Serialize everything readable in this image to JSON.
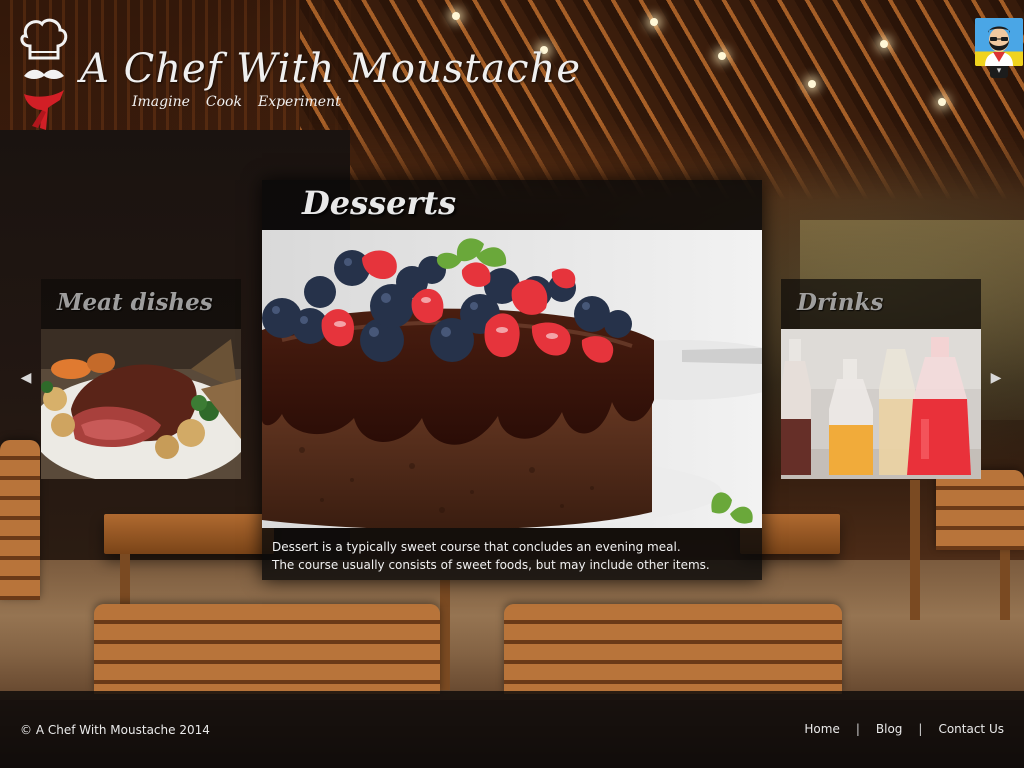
{
  "header": {
    "site_title": "A Chef With Moustache",
    "tagline": [
      "Imagine",
      "Cook",
      "Experiment"
    ]
  },
  "user": {
    "avatar_icon": "bearded-man-avatar-icon"
  },
  "carousel": {
    "prev_icon": "triangle-left-icon",
    "next_icon": "triangle-right-icon",
    "prev_glyph": "◀",
    "next_glyph": "▶",
    "left_card": {
      "title": "Meat dishes"
    },
    "main_card": {
      "title": "Desserts",
      "description_line1": "Dessert is a typically sweet course that concludes an evening meal.",
      "description_line2": "The course usually consists of sweet foods, but may include other items."
    },
    "right_card": {
      "title": "Drinks"
    }
  },
  "footer": {
    "copyright": "© A Chef With Moustache 2014",
    "nav": [
      "Home",
      "Blog",
      "Contact Us"
    ],
    "separator": "|"
  },
  "colors": {
    "chef_red": "#d21f26",
    "overlay_dark": "#0a0a0a"
  }
}
